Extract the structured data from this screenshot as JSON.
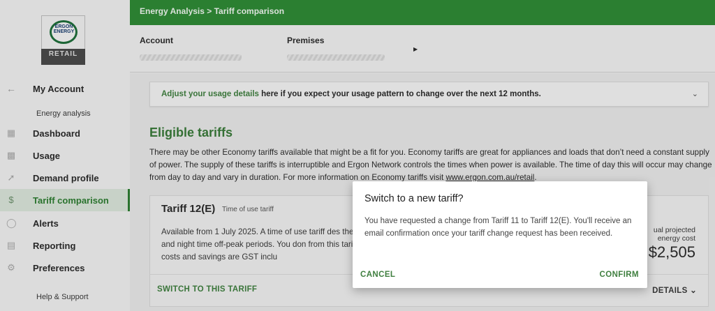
{
  "logo": {
    "brand_line1": "ERGON",
    "brand_line2": "ENERGY",
    "retail": "RETAIL"
  },
  "sidebar": {
    "back_label": "My Account",
    "section_label": "Energy analysis",
    "items": [
      {
        "label": "Dashboard",
        "icon": "dashboard-icon",
        "active": false
      },
      {
        "label": "Usage",
        "icon": "bar-chart-icon",
        "active": false
      },
      {
        "label": "Demand profile",
        "icon": "line-chart-icon",
        "active": false
      },
      {
        "label": "Tariff comparison",
        "icon": "dollar-icon",
        "active": true
      },
      {
        "label": "Alerts",
        "icon": "alerts-icon",
        "active": false
      },
      {
        "label": "Reporting",
        "icon": "report-icon",
        "active": false
      },
      {
        "label": "Preferences",
        "icon": "gear-icon",
        "active": false
      }
    ],
    "help": "Help & Support"
  },
  "header": {
    "breadcrumb": "Energy Analysis > Tariff comparison"
  },
  "account_bar": {
    "account_label": "Account",
    "premises_label": "Premises"
  },
  "adjust": {
    "link": "Adjust your usage details",
    "text": " here if you expect your usage pattern to change over the next 12 months."
  },
  "eligible": {
    "title": "Eligible tariffs",
    "paragraph": "There may be other Economy tariffs available that might be a fit for you. Economy tariffs are great for appliances and loads that don’t need a constant supply of power. The supply of these tariffs is interruptible and Ergon Network controls the times when power is available. The time of day this will occur may change from day to day and vary in duration. For more information on Economy tariffs visit ",
    "link": "www.ergon.com.au/retail",
    "after_link": "."
  },
  "tariff": {
    "name": "Tariff 12(E)",
    "type": "Time of use tariff",
    "description": "Available from 1 July 2025. A time of use tariff des the day and night time off-peak periods. You don from this tariff. All costs and savings are GST inclu",
    "projected_label_1": "ual projected",
    "projected_label_2": "energy cost",
    "projected_value": "$2,505",
    "switch_label": "SWITCH TO THIS TARIFF",
    "details_label": "DETAILS"
  },
  "modal": {
    "title": "Switch to a new tariff?",
    "body": "You have requested a change from Tariff 11 to Tariff 12(E). You'll receive an email confirmation once your tariff change request has been received.",
    "cancel": "CANCEL",
    "confirm": "CONFIRM"
  },
  "colors": {
    "brand_green": "#2f8a36",
    "accent_text": "#3f7f3f"
  }
}
